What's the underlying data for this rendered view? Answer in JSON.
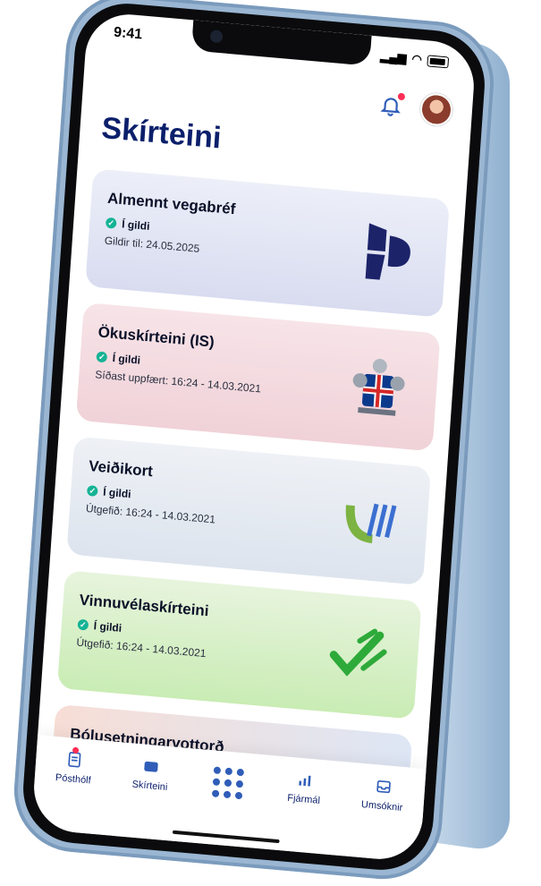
{
  "status_bar": {
    "time": "9:41"
  },
  "header": {
    "title": "Skírteini"
  },
  "cards": [
    {
      "title": "Almennt vegabréf",
      "status": "Í gildi",
      "meta": "Gildir til: 24.05.2025"
    },
    {
      "title": "Ökuskírteini (IS)",
      "status": "Í gildi",
      "meta": "Síðast uppfært: 16:24 - 14.03.2021"
    },
    {
      "title": "Veiðikort",
      "status": "Í gildi",
      "meta": "Útgefið: 16:24 - 14.03.2021"
    },
    {
      "title": "Vinnuvélaskírteini",
      "status": "Í gildi",
      "meta": "Útgefið: 16:24 - 14.03.2021"
    },
    {
      "title": "Bólusetningarvottorð"
    }
  ],
  "tabbar": {
    "items": [
      {
        "label": "Pósthólf",
        "icon": "inbox-icon"
      },
      {
        "label": "Skírteini",
        "icon": "wallet-icon"
      },
      {
        "label": "",
        "icon": "home-grid-icon"
      },
      {
        "label": "Fjármál",
        "icon": "bar-chart-icon"
      },
      {
        "label": "Umsóknir",
        "icon": "tray-icon"
      }
    ]
  },
  "colors": {
    "primary": "#0b1f6b",
    "accent": "#2f5db8",
    "notification": "#ff2d55",
    "valid_check": "#15b395"
  }
}
